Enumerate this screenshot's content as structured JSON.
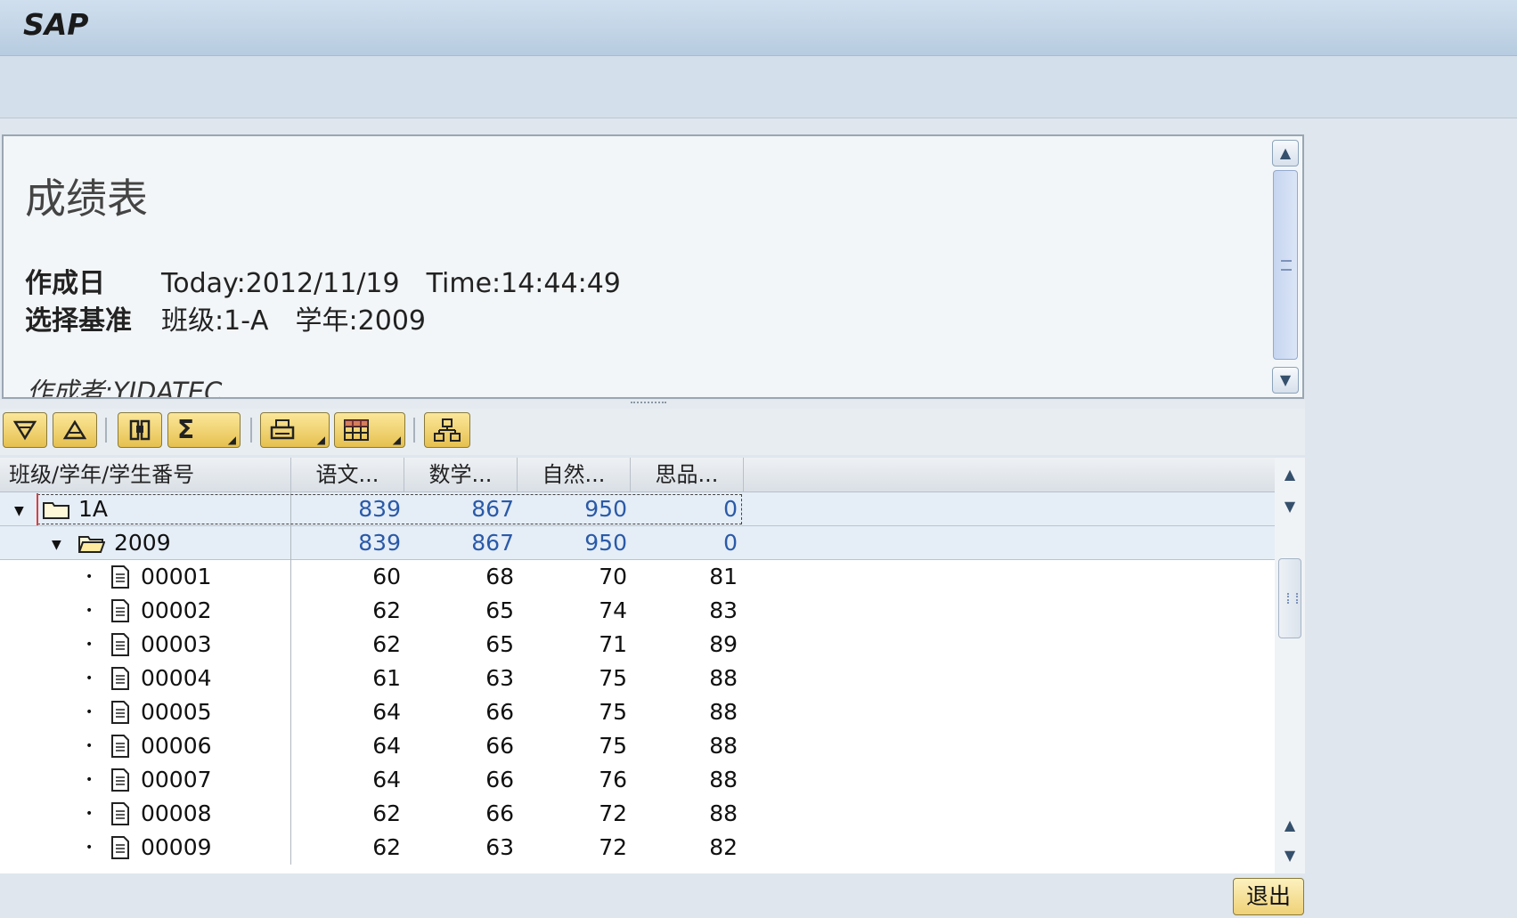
{
  "window": {
    "title": "SAP"
  },
  "header": {
    "title": "成绩表",
    "created_label": "作成日",
    "created_date": "Today:2012/11/19",
    "created_time": "Time:14:44:49",
    "criteria_label": "选择基准",
    "criteria_class": "班级:1-A",
    "criteria_year": "学年:2009",
    "author": "作成者:YIDATEC"
  },
  "toolbar": {
    "icons": [
      "expand-all-icon",
      "collapse-all-icon",
      "find-icon",
      "sum-icon",
      "print-icon",
      "layout-icon",
      "hierarchy-icon"
    ],
    "sum_label": "Σ"
  },
  "grid": {
    "columns": [
      "班级/学年/学生番号",
      "语文...",
      "数学...",
      "自然...",
      "思品..."
    ],
    "class_node": {
      "label": "1A",
      "values": [
        "839",
        "867",
        "950",
        "0"
      ]
    },
    "year_node": {
      "label": "2009",
      "values": [
        "839",
        "867",
        "950",
        "0"
      ]
    },
    "students": [
      {
        "id": "00001",
        "values": [
          "60",
          "68",
          "70",
          "81"
        ]
      },
      {
        "id": "00002",
        "values": [
          "62",
          "65",
          "74",
          "83"
        ]
      },
      {
        "id": "00003",
        "values": [
          "62",
          "65",
          "71",
          "89"
        ]
      },
      {
        "id": "00004",
        "values": [
          "61",
          "63",
          "75",
          "88"
        ]
      },
      {
        "id": "00005",
        "values": [
          "64",
          "66",
          "75",
          "88"
        ]
      },
      {
        "id": "00006",
        "values": [
          "64",
          "66",
          "75",
          "88"
        ]
      },
      {
        "id": "00007",
        "values": [
          "64",
          "66",
          "76",
          "88"
        ]
      },
      {
        "id": "00008",
        "values": [
          "62",
          "66",
          "72",
          "88"
        ]
      },
      {
        "id": "00009",
        "values": [
          "62",
          "63",
          "72",
          "82"
        ]
      }
    ]
  },
  "footer": {
    "exit_label": "退出"
  }
}
